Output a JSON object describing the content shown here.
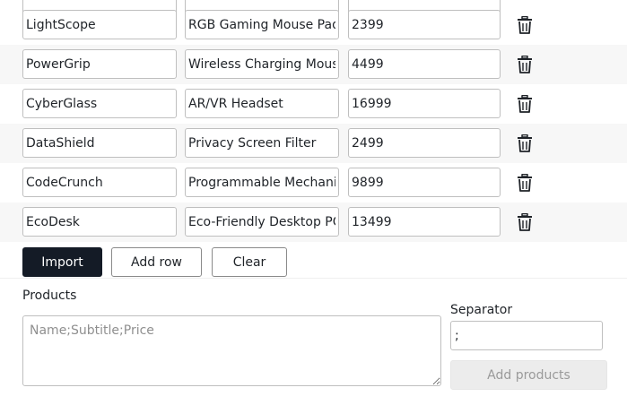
{
  "rows": [
    {
      "name": "LightScope",
      "subtitle": "RGB Gaming Mouse Pad",
      "price": "2399"
    },
    {
      "name": "PowerGrip",
      "subtitle": "Wireless Charging Mouse",
      "price": "4499"
    },
    {
      "name": "CyberGlass",
      "subtitle": "AR/VR Headset",
      "price": "16999"
    },
    {
      "name": "DataShield",
      "subtitle": "Privacy Screen Filter",
      "price": "2499"
    },
    {
      "name": "CodeCrunch",
      "subtitle": "Programmable Mechanical",
      "price": "9899"
    },
    {
      "name": "EcoDesk",
      "subtitle": "Eco-Friendly Desktop PC",
      "price": "13499"
    }
  ],
  "actions": {
    "import_label": "Import",
    "add_row_label": "Add row",
    "clear_label": "Clear"
  },
  "products": {
    "label": "Products",
    "placeholder": "Name;Subtitle;Price",
    "value": ""
  },
  "separator": {
    "label": "Separator",
    "value": ";"
  },
  "add_products": {
    "label": "Add products",
    "disabled": true
  },
  "icons": {
    "row_delete": "trash-icon"
  },
  "colors": {
    "primary_button": "#141b26",
    "stripe": "#f7f7f7",
    "disabled_button": "#ececec"
  }
}
